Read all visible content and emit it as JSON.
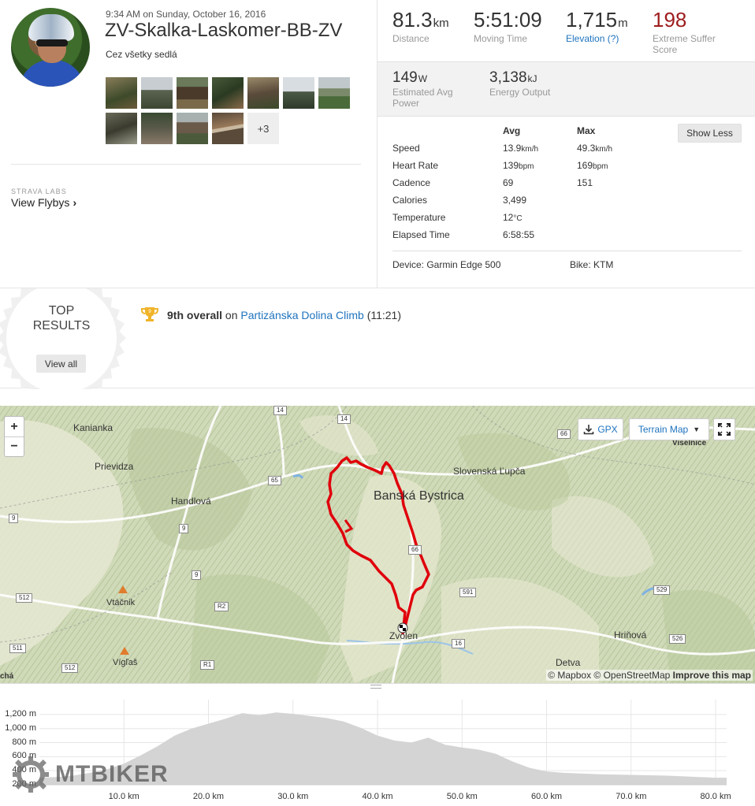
{
  "activity": {
    "datetime": "9:34 AM on Sunday, October 16, 2016",
    "title": "ZV-Skalka-Laskomer-BB-ZV",
    "description": "Cez všetky sedlá",
    "photos_more": "+3"
  },
  "labs": {
    "heading": "STRAVA LABS",
    "flybys": "View Flybys"
  },
  "stats": {
    "distance": {
      "value": "81.3",
      "unit": "km",
      "label": "Distance"
    },
    "moving_time": {
      "value": "5:51:09",
      "label": "Moving Time"
    },
    "elevation": {
      "value": "1,715",
      "unit": "m",
      "label": "Elevation (?)"
    },
    "suffer": {
      "value": "198",
      "label": "Extreme Suffer Score"
    },
    "power": {
      "value": "149",
      "unit": "W",
      "label": "Estimated Avg Power"
    },
    "energy": {
      "value": "3,138",
      "unit": "kJ",
      "label": "Energy Output"
    }
  },
  "detail_table": {
    "headers": [
      "Avg",
      "Max"
    ],
    "show_less": "Show Less",
    "rows": [
      {
        "label": "Speed",
        "avg": "13.9",
        "avg_unit": "km/h",
        "max": "49.3",
        "max_unit": "km/h"
      },
      {
        "label": "Heart Rate",
        "avg": "139",
        "avg_unit": "bpm",
        "max": "169",
        "max_unit": "bpm"
      },
      {
        "label": "Cadence",
        "avg": "69",
        "avg_unit": "",
        "max": "151",
        "max_unit": ""
      },
      {
        "label": "Calories",
        "avg": "3,499",
        "avg_unit": "",
        "max": "",
        "max_unit": ""
      },
      {
        "label": "Temperature",
        "avg": "12",
        "avg_unit": "°C",
        "max": "",
        "max_unit": ""
      },
      {
        "label": "Elapsed Time",
        "avg": "6:58:55",
        "avg_unit": "",
        "max": "",
        "max_unit": ""
      }
    ],
    "device": "Device: Garmin Edge 500",
    "bike": "Bike: KTM"
  },
  "top_results": {
    "badge_line1": "TOP",
    "badge_line2": "RESULTS",
    "view_all": "View all",
    "rank": "9th overall",
    "on": "on",
    "segment": "Partizánska Dolina Climb",
    "time": "(11:21)"
  },
  "map": {
    "zoom_in": "+",
    "zoom_out": "−",
    "gpx": "GPX",
    "terrain": "Terrain Map",
    "attribution_prefix": "© Mapbox © OpenStreetMap",
    "attribution_link": "Improve this map",
    "places": [
      "Kanianka",
      "Prievidza",
      "Handlová",
      "Banská Bystrica",
      "Slovenská Ľupča",
      "Vtáčnik",
      "Vígľaš",
      "Zvolen",
      "Hriňová",
      "Detva",
      "Viselnice",
      "chá"
    ],
    "roads": [
      "14",
      "14",
      "66",
      "65",
      "9",
      "9",
      "9",
      "66",
      "512",
      "R2",
      "591",
      "529",
      "511",
      "512",
      "R1",
      "16",
      "526"
    ]
  },
  "chart_data": {
    "type": "area",
    "title": "",
    "xlabel": "",
    "ylabel": "",
    "x_ticks": [
      "10.0 km",
      "20.0 km",
      "30.0 km",
      "40.0 km",
      "50.0 km",
      "60.0 km",
      "70.0 km",
      "80.0 km"
    ],
    "y_ticks": [
      "1,200 m",
      "1,000 m",
      "800 m",
      "600 m",
      "400 m",
      "200 m"
    ],
    "xlim": [
      0,
      81.3
    ],
    "ylim": [
      200,
      1300
    ],
    "x": [
      0,
      2,
      4,
      6,
      8,
      10,
      12,
      14,
      16,
      18,
      20,
      22,
      24,
      26,
      28,
      30,
      32,
      34,
      36,
      38,
      40,
      42,
      44,
      46,
      48,
      50,
      52,
      54,
      56,
      58,
      60,
      62,
      64,
      66,
      68,
      70,
      72,
      74,
      76,
      78,
      80,
      81.3
    ],
    "y": [
      300,
      310,
      330,
      370,
      420,
      500,
      620,
      750,
      900,
      1000,
      1070,
      1140,
      1220,
      1190,
      1230,
      1210,
      1180,
      1150,
      1100,
      1010,
      900,
      830,
      800,
      870,
      770,
      730,
      700,
      640,
      530,
      440,
      390,
      370,
      360,
      350,
      345,
      340,
      335,
      330,
      320,
      310,
      300,
      300
    ],
    "grid": true
  },
  "watermark": "MTBIKER"
}
